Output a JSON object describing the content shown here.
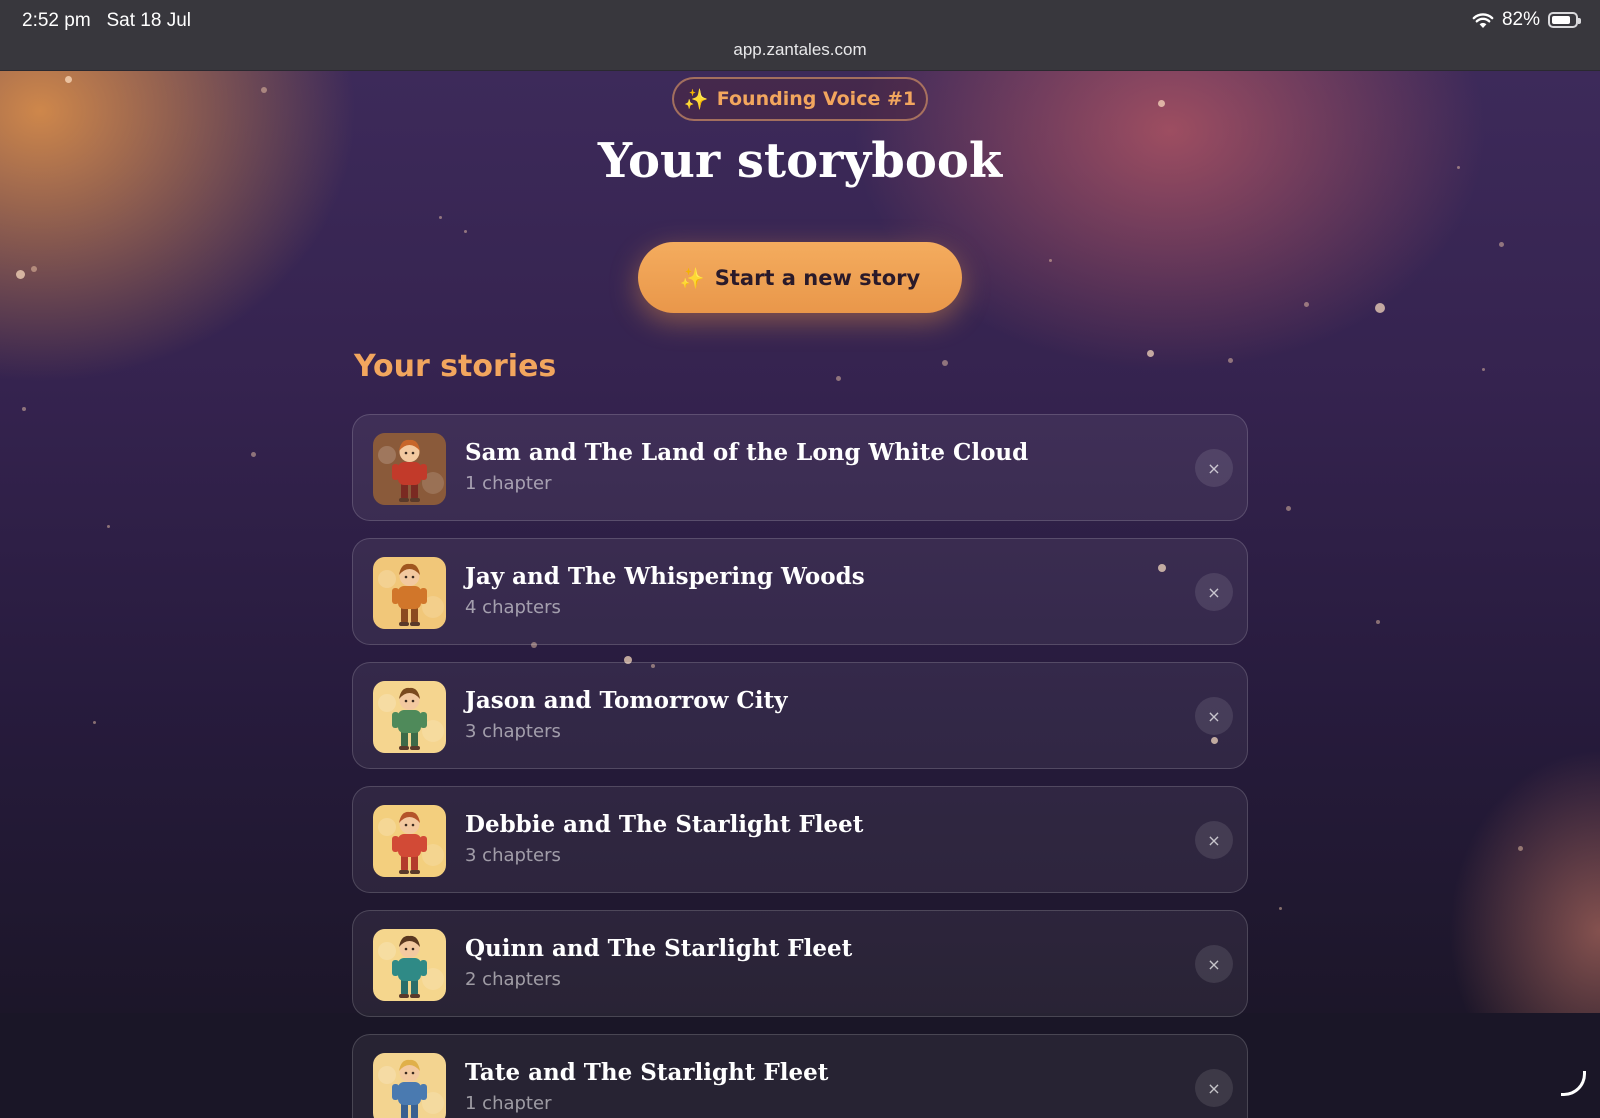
{
  "status_bar": {
    "time": "2:52 pm",
    "date": "Sat 18 Jul",
    "url": "app.zantales.com",
    "battery_percent": "82%",
    "battery_level": 0.82,
    "icons": [
      "wifi-icon",
      "battery-icon"
    ]
  },
  "badge": {
    "icon": "sparkle-icon",
    "label": "Founding Voice #1"
  },
  "page_title": "Your storybook",
  "start_button": {
    "icon": "sparkle-icon",
    "label": "Start a new story"
  },
  "section_title": "Your stories",
  "stories": [
    {
      "title": "Sam and The Land of the Long White Cloud",
      "chapters": "1 chapter",
      "delete_label": "×",
      "thumb_colors": {
        "bg": "#8a5a3a",
        "hair": "#c8662a",
        "shirt": "#c23a2a",
        "pants": "#7a2a22"
      }
    },
    {
      "title": "Jay and The Whispering Woods",
      "chapters": "4 chapters",
      "delete_label": "×",
      "thumb_colors": {
        "bg": "#f1c779",
        "hair": "#a0561f",
        "shirt": "#d1762a",
        "pants": "#8a4a1f"
      }
    },
    {
      "title": "Jason and Tomorrow City",
      "chapters": "3 chapters",
      "delete_label": "×",
      "thumb_colors": {
        "bg": "#f5d58f",
        "hair": "#7a4a1e",
        "shirt": "#4f8a5a",
        "pants": "#3d6a48"
      }
    },
    {
      "title": "Debbie and The Starlight Fleet",
      "chapters": "3 chapters",
      "delete_label": "×",
      "thumb_colors": {
        "bg": "#f3cf7e",
        "hair": "#b4542a",
        "shirt": "#d24a36",
        "pants": "#b33b2c"
      }
    },
    {
      "title": "Quinn and The Starlight Fleet",
      "chapters": "2 chapters",
      "delete_label": "×",
      "thumb_colors": {
        "bg": "#f5d68d",
        "hair": "#5a3820",
        "shirt": "#2f8a86",
        "pants": "#2a6e6a"
      }
    },
    {
      "title": "Tate and The Starlight Fleet",
      "chapters": "1 chapter",
      "delete_label": "×",
      "thumb_colors": {
        "bg": "#f3d490",
        "hair": "#e0b04a",
        "shirt": "#4a7ab0",
        "pants": "#3a6090"
      }
    }
  ],
  "colors": {
    "accent": "#f2a65e",
    "button": "#eea152"
  }
}
